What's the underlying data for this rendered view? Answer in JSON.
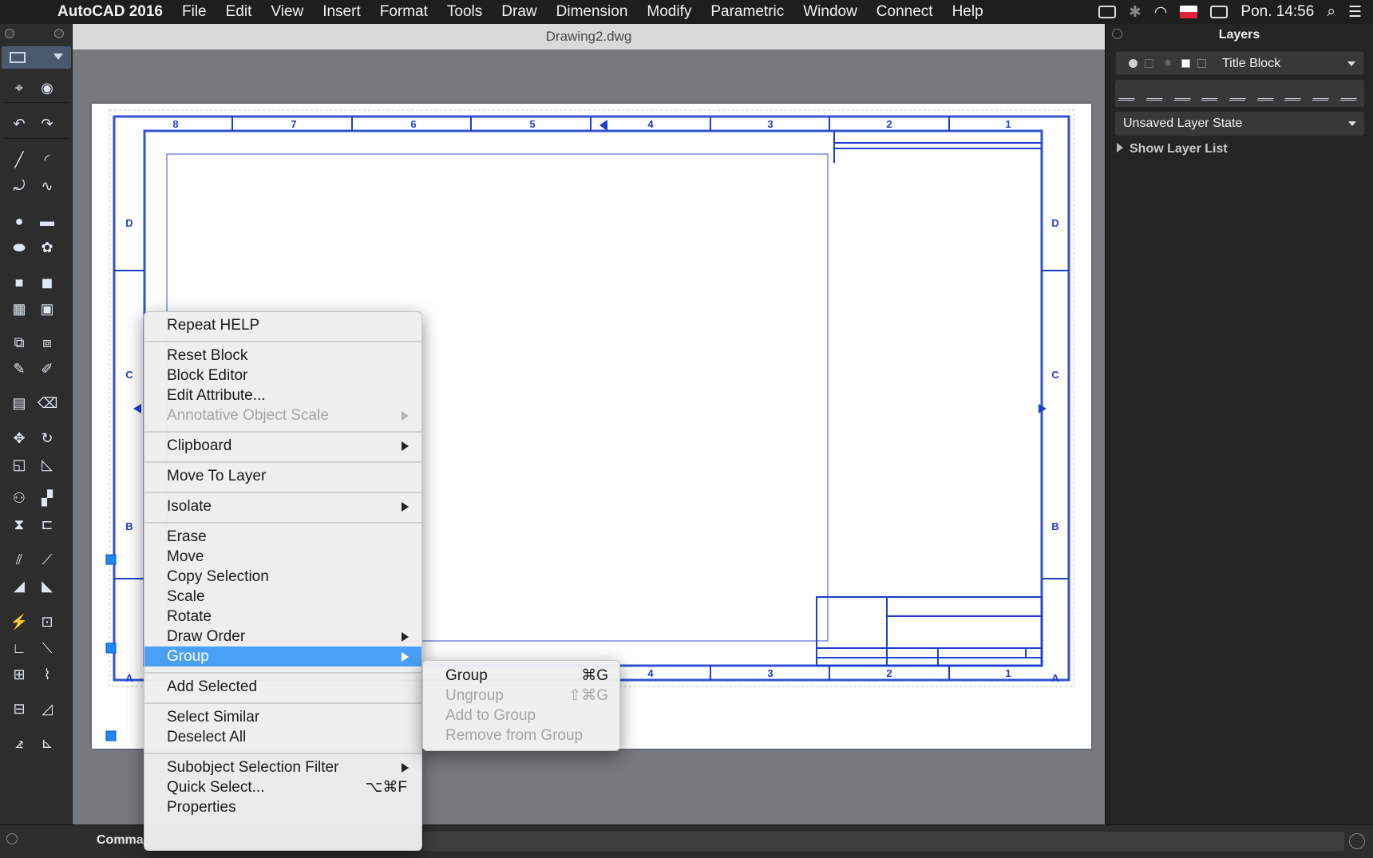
{
  "menubar": {
    "app_name": "AutoCAD 2016",
    "items": [
      "File",
      "Edit",
      "View",
      "Insert",
      "Format",
      "Tools",
      "Draw",
      "Dimension",
      "Modify",
      "Parametric",
      "Window",
      "Connect",
      "Help"
    ],
    "clock": "Pon. 14:56"
  },
  "document": {
    "title": "Drawing2.dwg"
  },
  "drawing": {
    "top_numbers": [
      "8",
      "7",
      "6",
      "5",
      "4",
      "3",
      "2",
      "1"
    ],
    "bottom_numbers": [
      "4",
      "3",
      "2",
      "1"
    ],
    "left_letters": [
      "D",
      "C",
      "B",
      "A"
    ],
    "right_letters": [
      "D",
      "C",
      "B",
      "A"
    ]
  },
  "layers_panel": {
    "title": "Layers",
    "current_layer": "Title Block",
    "layer_state": "Unsaved Layer State",
    "show_layer_list": "Show Layer List"
  },
  "command_line": {
    "label": "Comma"
  },
  "context_menu": {
    "items": [
      {
        "label": "Repeat HELP"
      },
      {
        "label": "Reset Block"
      },
      {
        "label": "Block Editor"
      },
      {
        "label": "Edit Attribute..."
      },
      {
        "label": "Annotative Object Scale"
      },
      {
        "label": "Clipboard"
      },
      {
        "label": "Move To Layer"
      },
      {
        "label": "Isolate"
      },
      {
        "label": "Erase"
      },
      {
        "label": "Move"
      },
      {
        "label": "Copy Selection"
      },
      {
        "label": "Scale"
      },
      {
        "label": "Rotate"
      },
      {
        "label": "Draw Order"
      },
      {
        "label": "Group"
      },
      {
        "label": "Add Selected"
      },
      {
        "label": "Select Similar"
      },
      {
        "label": "Deselect All"
      },
      {
        "label": "Subobject Selection Filter"
      },
      {
        "label": "Quick Select...",
        "shortcut": "⌥⌘F"
      },
      {
        "label": "Properties"
      }
    ]
  },
  "group_submenu": {
    "items": [
      {
        "label": "Group",
        "shortcut": "⌘G"
      },
      {
        "label": "Ungroup",
        "shortcut": "⇧⌘G"
      },
      {
        "label": "Add to Group"
      },
      {
        "label": "Remove from Group"
      }
    ]
  }
}
